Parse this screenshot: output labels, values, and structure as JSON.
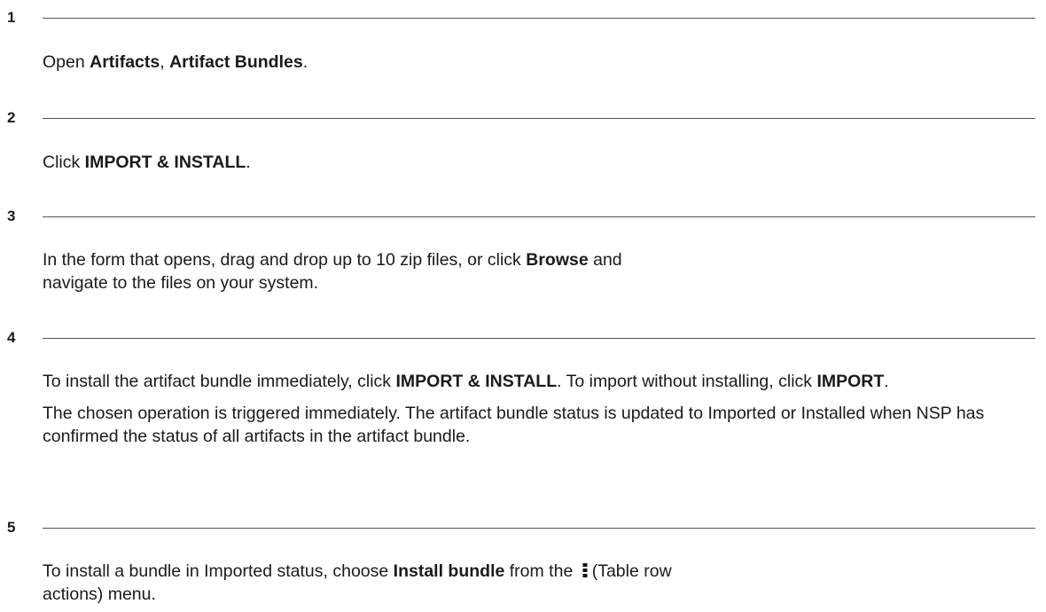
{
  "steps": [
    {
      "number": "1",
      "paragraphs": [
        {
          "before": "Open ",
          "b1": "Artifacts",
          "mid": ", ",
          "b2": "Artifact Bundles",
          "after": "."
        }
      ]
    },
    {
      "number": "2",
      "paragraphs": [
        {
          "before": "Click ",
          "b1": "IMPORT & INSTALL",
          "after": "."
        }
      ]
    },
    {
      "number": "3",
      "paragraphs": [
        {
          "before": "In the form that opens, drag and drop up to 10 zip files, or click ",
          "b1": "Browse",
          "after": " and navigate to the files on your system."
        }
      ]
    },
    {
      "number": "4",
      "paragraphs": [
        {
          "before": "To install the artifact bundle immediately, click ",
          "b1": "IMPORT & INSTALL",
          "mid": ". To import without installing, click ",
          "b2": "IMPORT",
          "after": "."
        },
        {
          "text": "The chosen operation is triggered immediately. The artifact bundle status is updated to Imported or Installed when NSP has confirmed the status of all artifacts in the artifact bundle."
        }
      ]
    },
    {
      "number": "5",
      "paragraphs": [
        {
          "before": "To install a bundle in Imported status, choose ",
          "b1": "Install bundle",
          "mid": " from the ",
          "icon": "kebab-menu-icon",
          "after": "(Table row actions) menu."
        }
      ]
    }
  ]
}
